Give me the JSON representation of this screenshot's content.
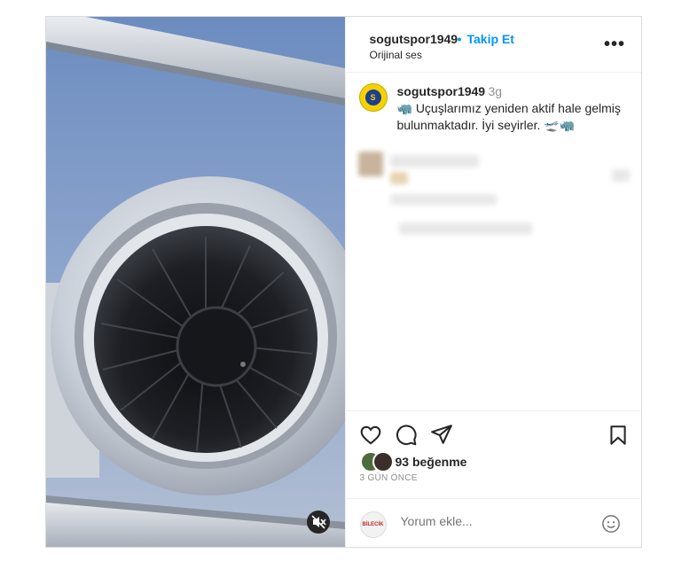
{
  "header": {
    "username": "sogutspor1949",
    "separator": "•",
    "follow_label": "Takip Et",
    "audio_label": "Orijinal ses",
    "more_label": "•••"
  },
  "caption": {
    "username": "sogutspor1949",
    "time": "3g",
    "text": "🦏 Uçuşlarımız yeniden aktif hale gelmiş bulunmaktadır. İyi seyirler. 🛫🦏",
    "avatar_text": "S"
  },
  "engagement": {
    "likes_text": "93 beğenme",
    "time_ago": "3 GÜN ÖNCE"
  },
  "comment": {
    "placeholder": "Yorum ekle...",
    "avatar_text": "BİLECİK"
  },
  "icons": {
    "like": "heart-icon",
    "comment": "comment-icon",
    "share": "send-icon",
    "save": "bookmark-icon",
    "emoji": "smiley-icon",
    "mute": "speaker-muted-icon"
  },
  "colors": {
    "link": "#0095f6",
    "text": "#262626",
    "muted": "#8e8e8e",
    "border": "#dbdbdb"
  }
}
